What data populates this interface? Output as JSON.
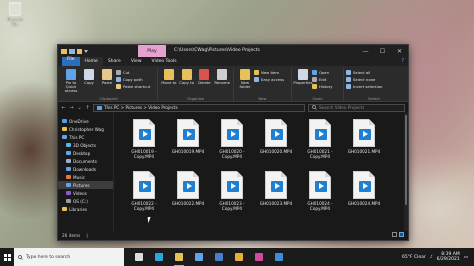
{
  "desktop": {
    "recycle_bin_label": "Recycle Bin"
  },
  "window": {
    "manage_tab": "Play",
    "title": "C:\\Users\\CWag\\Pictures\\Video Projects",
    "minimize": "—",
    "maximize": "☐",
    "close": "✕"
  },
  "ribbon_tabs": [
    "File",
    "Home",
    "Share",
    "View",
    "Video Tools"
  ],
  "help_icon": "?",
  "ribbon": {
    "clipboard": {
      "pin_label": "Pin to Quick access",
      "copy_label": "Copy",
      "paste_label": "Paste",
      "cut_label": "Cut",
      "copy_path_label": "Copy path",
      "paste_shortcut_label": "Paste shortcut",
      "group_label": "Clipboard"
    },
    "organize": {
      "move_label": "Move to",
      "copy_to_label": "Copy to",
      "delete_label": "Delete",
      "rename_label": "Rename",
      "group_label": "Organize"
    },
    "new": {
      "new_folder_label": "New folder",
      "new_item_label": "New item",
      "easy_access_label": "Easy access",
      "group_label": "New"
    },
    "open": {
      "properties_label": "Properties",
      "open_label": "Open",
      "edit_label": "Edit",
      "history_label": "History",
      "group_label": "Open"
    },
    "select": {
      "select_all_label": "Select all",
      "select_none_label": "Select none",
      "invert_label": "Invert selection",
      "group_label": "Select"
    }
  },
  "address": {
    "back": "←",
    "forward": "→",
    "up_history": "⌄",
    "up": "↑",
    "path": "This PC  >  Pictures  >  Video Projects",
    "search_placeholder": "Search Video Projects"
  },
  "nav_pane": [
    {
      "label": "OneDrive",
      "color": "#4aa0ec"
    },
    {
      "label": "Christopher Wag",
      "color": "#e6c15a"
    },
    {
      "label": "This PC",
      "color": "#5fa3e8"
    },
    {
      "label": "3D Objects",
      "color": "#5fb3e8"
    },
    {
      "label": "Desktop",
      "color": "#5fa3e8"
    },
    {
      "label": "Documents",
      "color": "#9ab0c8"
    },
    {
      "label": "Downloads",
      "color": "#5fa3e8"
    },
    {
      "label": "Music",
      "color": "#e07b3a"
    },
    {
      "label": "Pictures",
      "color": "#5fa3e8",
      "selected": true
    },
    {
      "label": "Videos",
      "color": "#8a5cd0"
    },
    {
      "label": "OS (C:)",
      "color": "#9a9a9a"
    },
    {
      "label": "Libraries",
      "color": "#e6c15a"
    }
  ],
  "files": [
    {
      "line1": "GH010019 -",
      "line2": "Copy.MP4"
    },
    {
      "line1": "GH010019.MP4",
      "line2": ""
    },
    {
      "line1": "GH010020 -",
      "line2": "Copy.MP4"
    },
    {
      "line1": "GH010020.MP4",
      "line2": ""
    },
    {
      "line1": "GH010021 -",
      "line2": "Copy.MP4"
    },
    {
      "line1": "GH010021.MP4",
      "line2": ""
    },
    {
      "line1": "GH010022 -",
      "line2": "Copy.MP4"
    },
    {
      "line1": "GH010022.MP4",
      "line2": ""
    },
    {
      "line1": "GH010023 -",
      "line2": "Copy.MP4"
    },
    {
      "line1": "GH010023.MP4",
      "line2": ""
    },
    {
      "line1": "GH010024 -",
      "line2": "Copy.MP4"
    },
    {
      "line1": "GH010024.MP4",
      "line2": ""
    }
  ],
  "status": {
    "item_count": "26 items",
    "separator": "|"
  },
  "taskbar": {
    "search_placeholder": "Type here to search",
    "apps": [
      {
        "name": "task-view-icon",
        "color": "#dddddd"
      },
      {
        "name": "edge-icon",
        "color": "#2fa5d8"
      },
      {
        "name": "file-explorer-icon",
        "color": "#e6c15a",
        "active": true
      },
      {
        "name": "store-icon",
        "color": "#5fa3e8"
      },
      {
        "name": "mail-icon",
        "color": "#4a7fc8"
      },
      {
        "name": "chrome-icon",
        "color": "#e0b23a"
      },
      {
        "name": "app-icon",
        "color": "#d04aa0"
      },
      {
        "name": "photos-icon",
        "color": "#3a8fd8"
      }
    ],
    "weather": "65°F  Clear",
    "time": "8:39 AM",
    "date": "6/29/2021"
  },
  "colors": {
    "accent": "#2a6fbb",
    "manage_tab": "#e6a1d0",
    "video_icon": "#1f7fd1"
  }
}
